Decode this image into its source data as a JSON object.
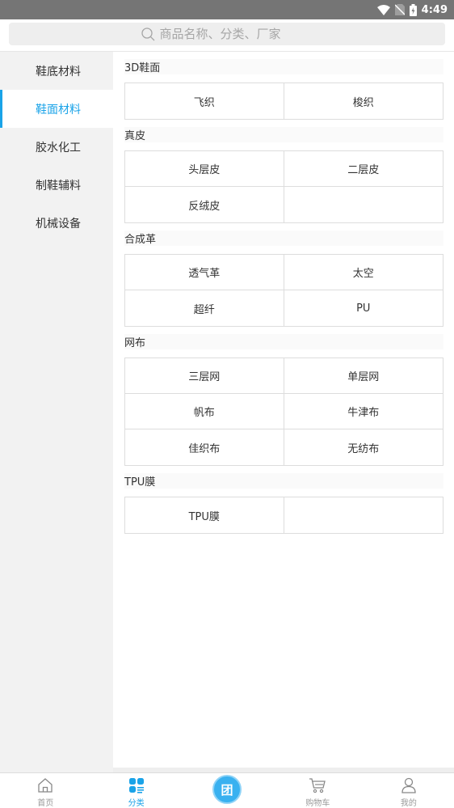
{
  "status_bar": {
    "time": "4:49"
  },
  "search": {
    "placeholder": "商品名称、分类、厂家"
  },
  "sidebar": {
    "items": [
      {
        "label": "鞋底材料"
      },
      {
        "label": "鞋面材料"
      },
      {
        "label": "胶水化工"
      },
      {
        "label": "制鞋辅料"
      },
      {
        "label": "机械设备"
      }
    ],
    "active_index": 1
  },
  "sections": [
    {
      "title": "3D鞋面",
      "items": [
        "飞织",
        "梭织"
      ]
    },
    {
      "title": "真皮",
      "items": [
        "头层皮",
        "二层皮",
        "反绒皮",
        ""
      ]
    },
    {
      "title": "合成革",
      "items": [
        "透气革",
        "太空",
        "超纤",
        "PU"
      ]
    },
    {
      "title": "网布",
      "items": [
        "三层网",
        "单层网",
        "帆布",
        "牛津布",
        "佳织布",
        "无纺布"
      ]
    },
    {
      "title": "TPU膜",
      "items": [
        "TPU膜",
        ""
      ]
    }
  ],
  "bottom_nav": {
    "home": "首页",
    "category": "分类",
    "center": "团",
    "cart": "购物车",
    "mine": "我的"
  },
  "colors": {
    "accent": "#1aa3e8",
    "status_bar": "#757575"
  },
  "icons": [
    "wifi-icon",
    "no-sim-icon",
    "battery-icon",
    "search-icon",
    "home-icon",
    "category-icon",
    "cart-icon",
    "user-icon"
  ]
}
